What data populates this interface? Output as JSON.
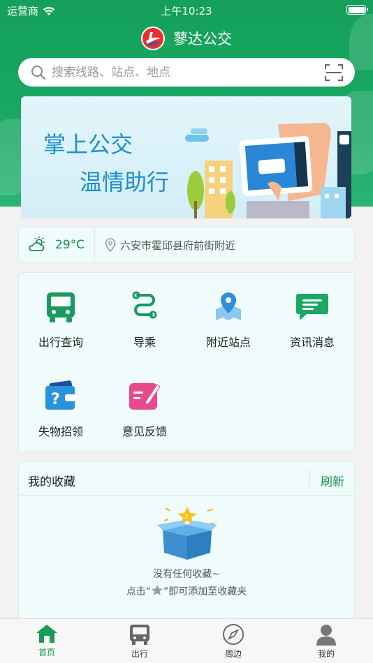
{
  "status": {
    "carrier": "运营商",
    "time": "上午10:23"
  },
  "app": {
    "title": "蓼达公交"
  },
  "search": {
    "placeholder": "搜索线路、站点、地点",
    "search_icon": "search-icon",
    "scan_icon": "scan-icon"
  },
  "banner": {
    "line1": "掌上公交",
    "line2": "温情助行"
  },
  "weather": {
    "temp": "29°C",
    "location": "六安市霍邱县府前街附近",
    "icon": "partly-cloudy-icon"
  },
  "menu": [
    {
      "label": "出行查询",
      "icon": "bus-icon"
    },
    {
      "label": "导乘",
      "icon": "route-icon"
    },
    {
      "label": "附近站点",
      "icon": "map-pin-icon"
    },
    {
      "label": "资讯消息",
      "icon": "message-icon"
    },
    {
      "label": "失物招领",
      "icon": "wallet-question-icon"
    },
    {
      "label": "意见反馈",
      "icon": "edit-icon"
    }
  ],
  "favorites": {
    "title": "我的收藏",
    "refresh": "刷新",
    "empty_title": "没有任何收藏~",
    "empty_hint_prefix": "点击“",
    "empty_hint_suffix": "”即可添加至收藏夹"
  },
  "tabs": [
    {
      "label": "首页",
      "icon": "home-icon",
      "active": true
    },
    {
      "label": "出行",
      "icon": "bus-icon",
      "active": false
    },
    {
      "label": "周边",
      "icon": "compass-icon",
      "active": false
    },
    {
      "label": "我的",
      "icon": "user-icon",
      "active": false
    }
  ],
  "colors": {
    "brand": "#1aa864",
    "accent_text": "#1a8f52",
    "card_bg": "#effcfb"
  }
}
